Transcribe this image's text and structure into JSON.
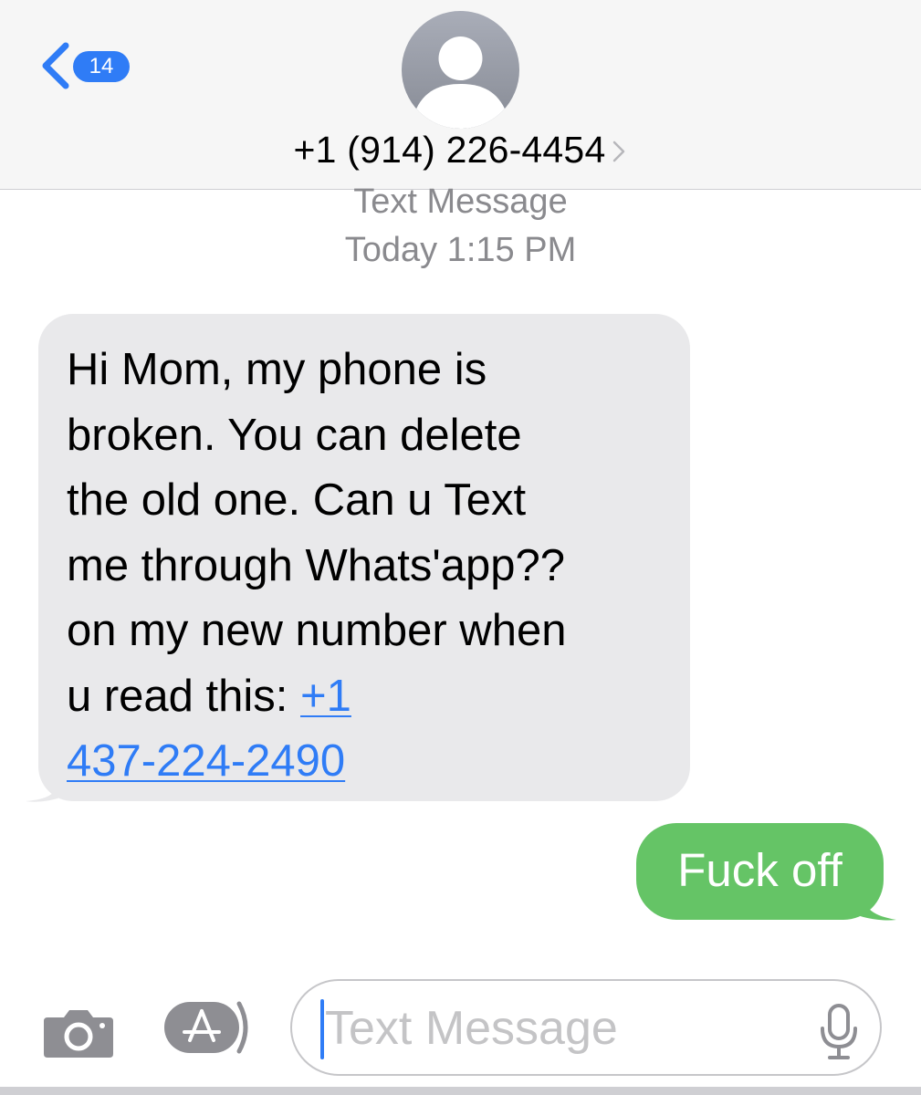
{
  "header": {
    "back_badge_count": "14",
    "contact_number": "+1 (914) 226-4454",
    "icons": {
      "back": "chevron-left-icon",
      "avatar": "person-icon",
      "details": "chevron-right-icon"
    }
  },
  "thread": {
    "service_label": "Text Message",
    "timestamp": "Today 1:15 PM",
    "incoming_message": {
      "text": "Hi Mom, my phone is\nbroken. You can delete\nthe old one. Can u Text\nme through Whats'app??\non my new number when\nu read this: ",
      "link_text": "+1\n437-224-2490"
    },
    "outgoing_message": {
      "text": "Fuck off"
    }
  },
  "composer": {
    "placeholder": "Text Message",
    "value": "",
    "icons": {
      "camera": "camera-icon",
      "apps": "app-store-icon",
      "mic": "microphone-icon"
    }
  },
  "colors": {
    "accent": "#2f7cf6",
    "incoming_bubble": "#e9e9eb",
    "outgoing_bubble": "#65c466",
    "meta_text": "#8a8a8e",
    "header_bg": "#f6f6f6"
  }
}
